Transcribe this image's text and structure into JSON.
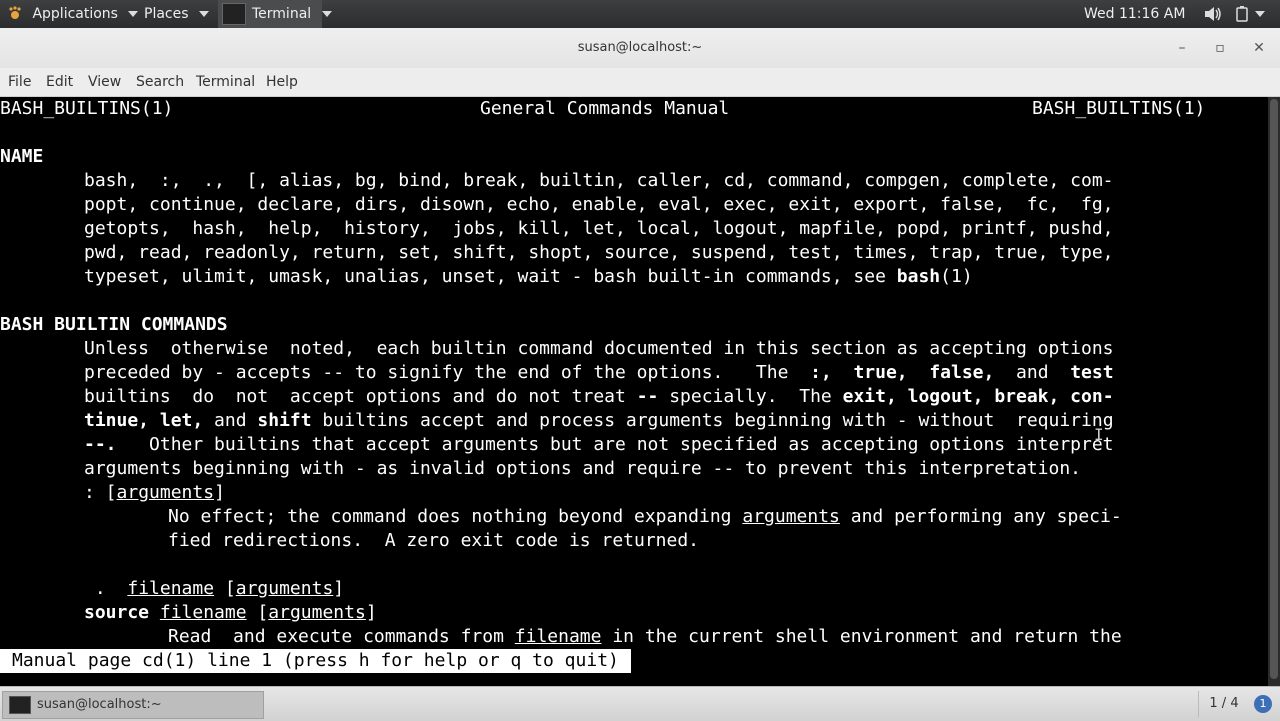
{
  "top_panel": {
    "applications": "Applications",
    "places": "Places",
    "terminal": "Terminal",
    "clock": "Wed 11:16 AM"
  },
  "window": {
    "title": "susan@localhost:~",
    "minimize": "–",
    "maximize": "▫",
    "close": "✕"
  },
  "menu": {
    "file": "File",
    "edit": "Edit",
    "view": "View",
    "search": "Search",
    "terminal": "Terminal",
    "help": "Help"
  },
  "man": {
    "header_left": "BASH_BUILTINS(1)",
    "header_center": "General Commands Manual",
    "header_right": "BASH_BUILTINS(1)",
    "name_heading": "NAME",
    "name_lines": [
      "bash,  :,  .,  [, alias, bg, bind, break, builtin, caller, cd, command, compgen, complete, com-",
      "popt, continue, declare, dirs, disown, echo, enable, eval, exec, exit, export, false,  fc,  fg,",
      "getopts,  hash,  help,  history,  jobs, kill, let, local, logout, mapfile, popd, printf, pushd,",
      "pwd, read, readonly, return, set, shift, shopt, source, suspend, test, times, trap, true, type,",
      "typeset, ulimit, umask, unalias, unset, wait - bash built-in commands, see "
    ],
    "name_bash_ref": "bash",
    "name_bash_sec": "(1)",
    "builtin_heading": "BASH BUILTIN COMMANDS",
    "p1_l1": "Unless  otherwise  noted,  each builtin command documented in this section as accepting options",
    "p1_l2a": "preceded by - accepts -- to signify the end of the options.   The  ",
    "p1_l2_colon": ":,",
    "p1_l2_sp1": "  ",
    "p1_l2_true": "true,",
    "p1_l2_sp2": "  ",
    "p1_l2_false": "false,",
    "p1_l2_and": "  and  ",
    "p1_l2_test": "test",
    "p1_l3a": "builtins  do  not  accept options and do not treat ",
    "p1_l3_dd": "--",
    "p1_l3b": " specially.  The ",
    "p1_l3_bold": "exit, logout, break, con-",
    "p1_l4_bold": "tinue, let,",
    "p1_l4_and": " and ",
    "p1_l4_shift": "shift",
    "p1_l4b": " builtins accept and process arguments beginning with - without  requiring",
    "p1_l5_bold": "--.",
    "p1_l5b": "   Other builtins that accept arguments but are not specified as accepting options interpret",
    "p1_l6": "arguments beginning with - as invalid options and require -- to prevent this interpretation.",
    "colon_cmd": ": [",
    "colon_args": "arguments",
    "colon_close": "]",
    "colon_desc1a": "No effect; the command does nothing beyond expanding ",
    "colon_desc1_args": "arguments",
    "colon_desc1b": " and performing any speci-",
    "colon_desc2": "fied redirections.  A zero exit code is returned.",
    "dot_cmd": " .  ",
    "dot_filename": "filename",
    "dot_sp": " [",
    "dot_args": "arguments",
    "dot_close": "]",
    "source_cmd": "source",
    "source_sp": " ",
    "source_filename": "filename",
    "source_sp2": " [",
    "source_args": "arguments",
    "source_close": "]",
    "source_desc_a": "Read  and execute commands from ",
    "source_desc_filename": "filename",
    "source_desc_b": " in the current shell environment and return the",
    "status": "Manual page cd(1) line 1 (press h for help or q to quit)"
  },
  "taskbar": {
    "task_label": "susan@localhost:~",
    "workspace": "1 / 4",
    "notifications": "1"
  }
}
